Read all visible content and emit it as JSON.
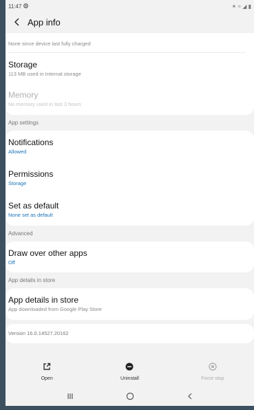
{
  "status_bar": {
    "time": "11:47",
    "right_icons": "✶ ≈ ◢ ▮"
  },
  "app_bar": {
    "title": "App info"
  },
  "top_card": {
    "battery_sub": "None since device last fully charged"
  },
  "storage": {
    "title": "Storage",
    "sub": "113 MB used in Internal storage"
  },
  "memory": {
    "title": "Memory",
    "sub": "No memory used in last 3 hours"
  },
  "sections": {
    "app_settings": "App settings",
    "advanced": "Advanced",
    "app_details_store": "App details in store"
  },
  "notifications": {
    "title": "Notifications",
    "sub": "Allowed"
  },
  "permissions": {
    "title": "Permissions",
    "sub": "Storage"
  },
  "set_default": {
    "title": "Set as default",
    "sub": "None set as default"
  },
  "draw_over": {
    "title": "Draw over other apps",
    "sub": "Off"
  },
  "app_details": {
    "title": "App details in store",
    "sub": "App downloaded from Google Play Store"
  },
  "version": "Version 16.0.14527.20162",
  "actions": {
    "open": "Open",
    "uninstall": "Uninstall",
    "force_stop": "Force stop"
  },
  "colors": {
    "accent_blue": "#1a73b8",
    "background": "#f2f2f2",
    "frame": "#3d5060"
  }
}
